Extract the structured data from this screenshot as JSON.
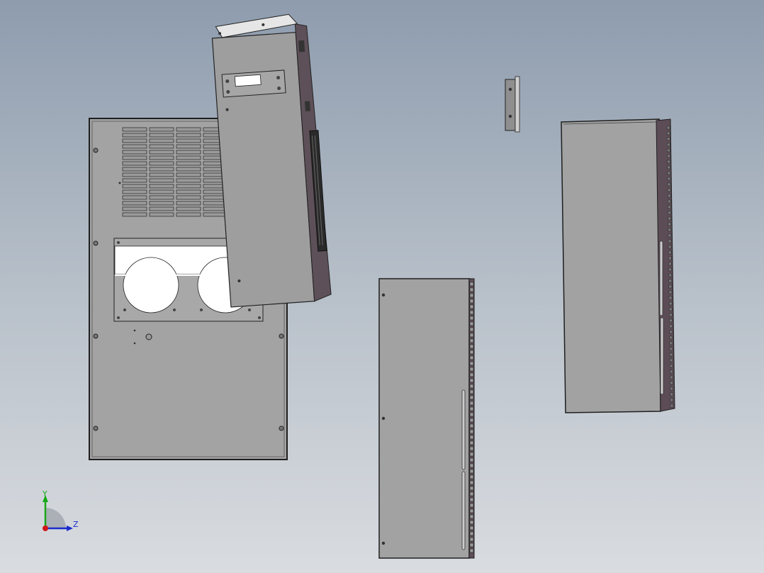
{
  "triad": {
    "y_label": "Y",
    "z_label": "Z",
    "colors": {
      "y": "#18a818",
      "z": "#1a2ccc",
      "x": "#d01818"
    }
  },
  "colors": {
    "background_top": "#8e9cae",
    "background_bottom": "#d9dce0",
    "panel_face": "#a2a2a2",
    "panel_edge": "#2a2a2a",
    "side_strip": "#6b5a62",
    "cutout": "#ffffff"
  }
}
